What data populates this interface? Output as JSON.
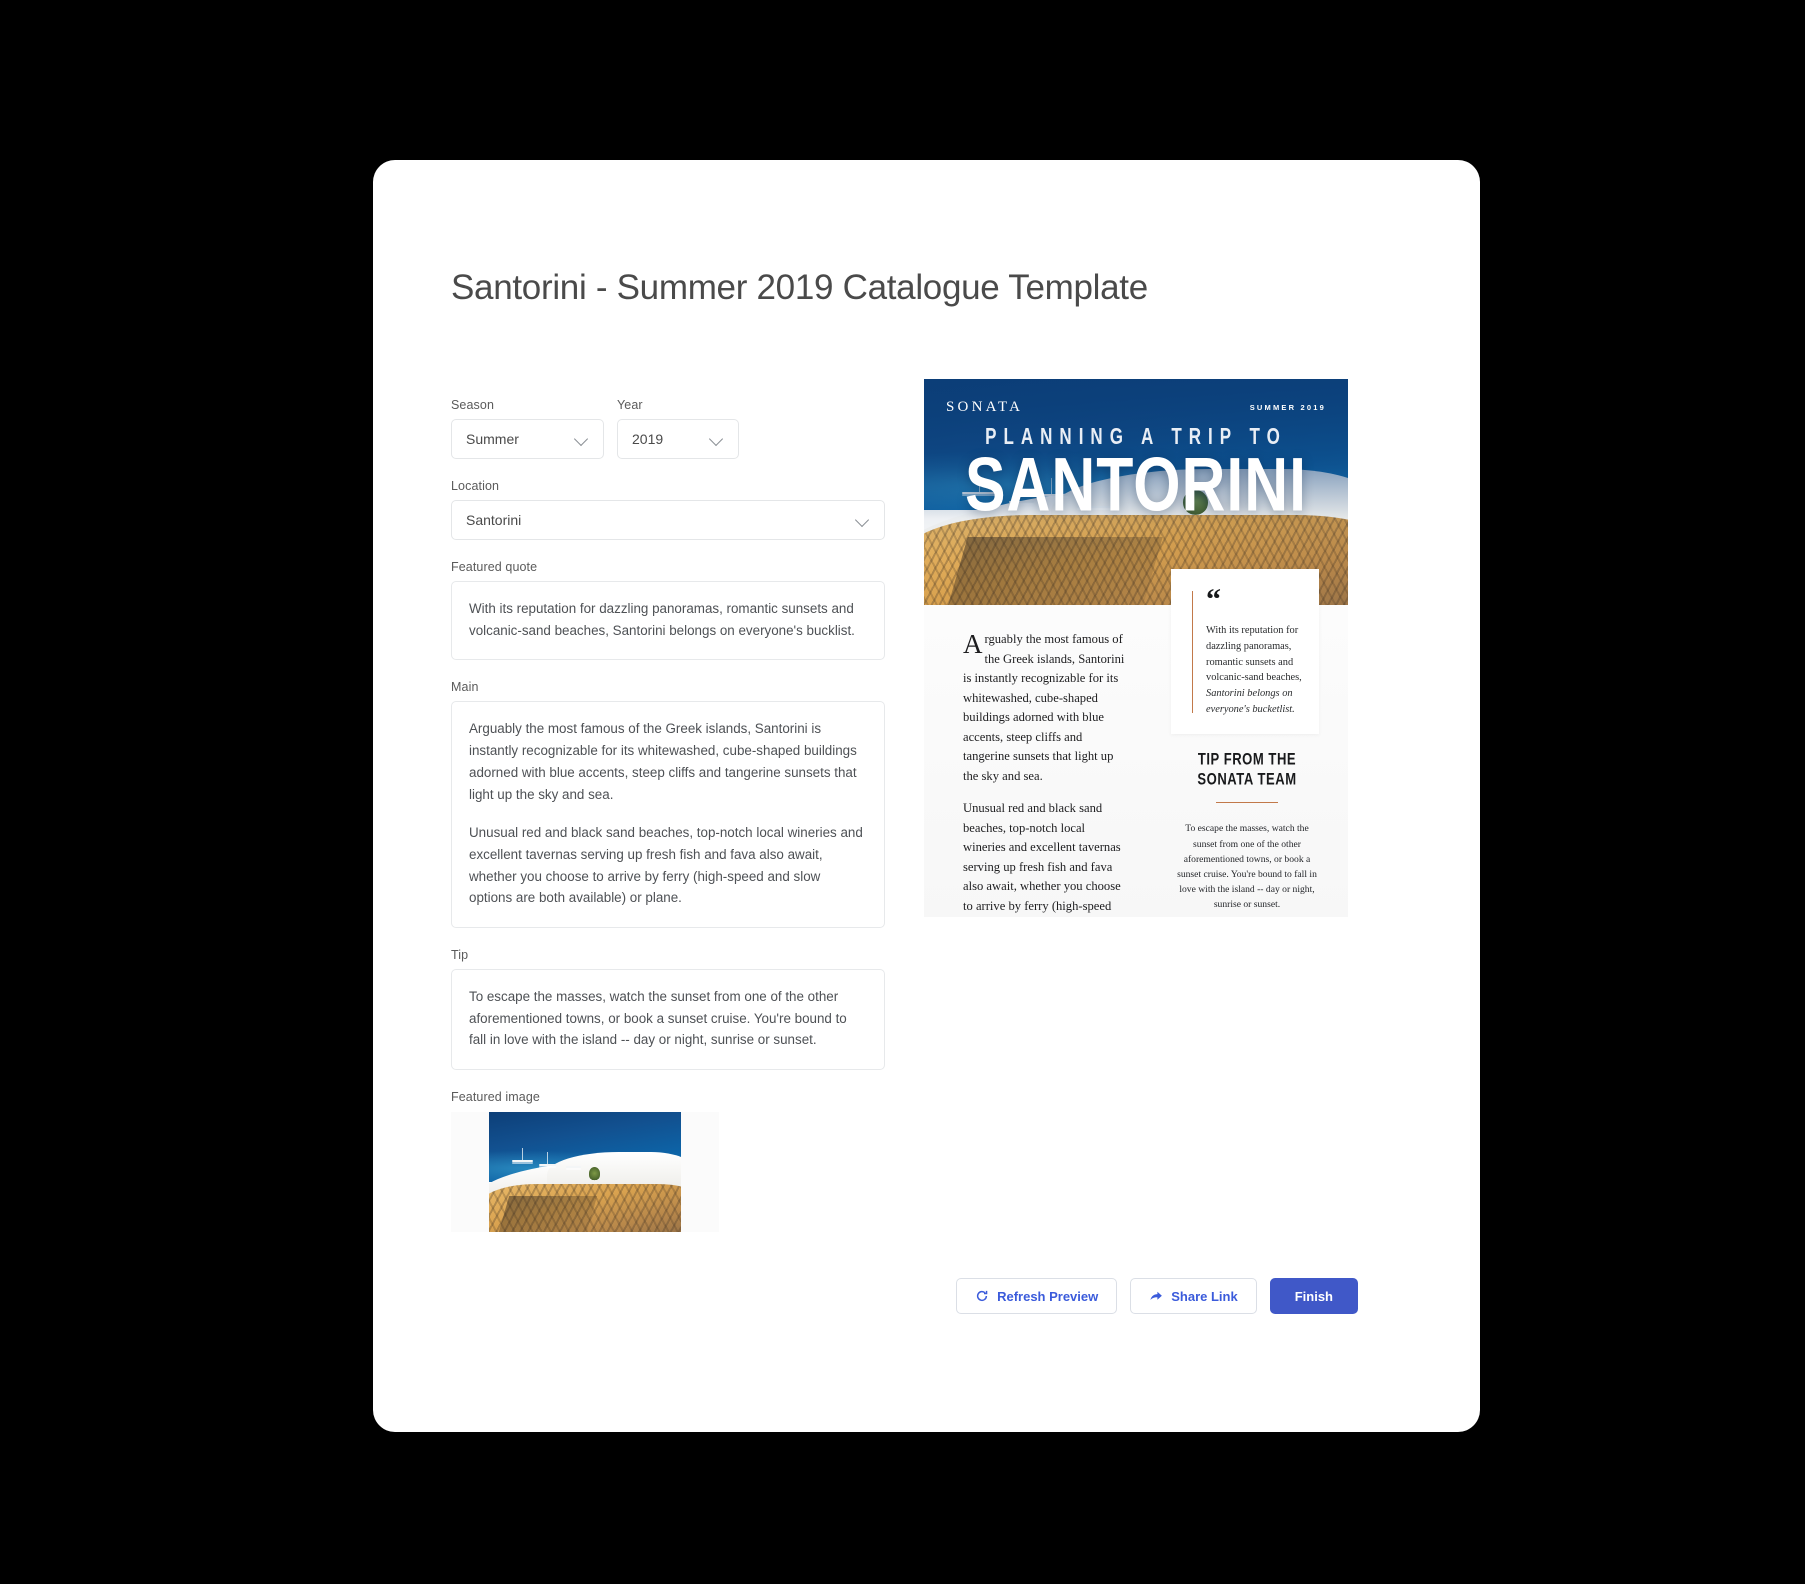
{
  "page": {
    "title": "Santorini - Summer 2019 Catalogue Template",
    "background_color": "#000000",
    "card_color": "#ffffff"
  },
  "form": {
    "season": {
      "label": "Season",
      "value": "Summer"
    },
    "year": {
      "label": "Year",
      "value": "2019"
    },
    "location": {
      "label": "Location",
      "value": "Santorini"
    },
    "featured_quote": {
      "label": "Featured quote",
      "value": "With its reputation for dazzling panoramas, romantic sunsets and volcanic-sand beaches, Santorini belongs on everyone's bucklist."
    },
    "main": {
      "label": "Main",
      "paragraph_1": "Arguably the most famous of the Greek islands, Santorini is instantly recognizable for its whitewashed, cube-shaped buildings adorned with blue accents, steep cliffs and tangerine sunsets that light up the sky and sea.",
      "paragraph_2": "Unusual red and black sand beaches, top-notch local wineries and excellent tavernas serving up fresh fish and fava also await, whether you choose to arrive by ferry (high-speed and slow options are both available) or plane."
    },
    "tip": {
      "label": "Tip",
      "value": "To escape the masses, watch the sunset from one of the other aforementioned towns, or book a sunset cruise. You're bound to fall in love with the island -- day or night, sunrise or sunset."
    },
    "featured_image": {
      "label": "Featured image"
    }
  },
  "preview": {
    "brand": "SONATA",
    "issue": "SUMMER 2019",
    "kicker": "PLANNING A TRIP TO",
    "headline": "SANTORINI",
    "body_paragraph_1": "Arguably the most famous of the Greek islands, Santorini is instantly recognizable for its whitewashed, cube-shaped buildings adorned with blue accents, steep cliffs and tangerine sunsets that light up the sky and sea.",
    "body_paragraph_2": "Unusual red and black sand beaches, top-notch local wineries and excellent tavernas serving up fresh fish and fava also await, whether you choose to arrive by ferry (high-speed and slow options are both available) or plane.",
    "quote_mark": "“",
    "quote_line_1": "With its reputation for dazzling panoramas, romantic sunsets and volcanic-sand beaches, ",
    "quote_line_2": "Santorini belongs on everyone's bucketlist.",
    "tip_title": "TIP FROM THE SONATA TEAM",
    "tip_body": "To escape the masses, watch the sunset from one of the other aforementioned towns, or book a sunset cruise. You're bound to fall in love with the island -- day or night, sunrise or sunset.",
    "accent_rule_color": "#c2794a",
    "hero_color": "#0b3e78"
  },
  "actions": {
    "refresh_label": "Refresh Preview",
    "share_label": "Share Link",
    "finish_label": "Finish",
    "primary_color": "#4058c8",
    "link_color": "#3b5bdb"
  }
}
